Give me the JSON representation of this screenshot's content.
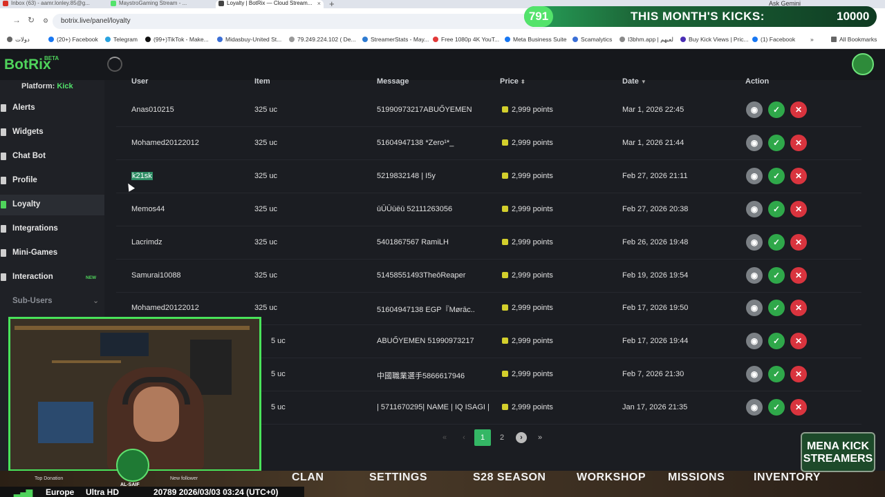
{
  "browser": {
    "tabs": [
      {
        "title": "Inbox (63) - aamr.lonley.85@g...",
        "color": "#d93025"
      },
      {
        "title": "MaystroGaming Stream - ...",
        "color": "#53e36b"
      },
      {
        "title": "Loyalty | BotRix — Cloud Stream...",
        "color": "#444444"
      }
    ],
    "new_tab": "+",
    "ask_gemini": "Ask Gemini",
    "url": "botrix.live/panel/loyalty",
    "bookmarks": [
      {
        "label": "دولات",
        "color": "#666666"
      },
      {
        "label": "(20+) Facebook",
        "color": "#1877f2"
      },
      {
        "label": "Telegram",
        "color": "#2aa3df"
      },
      {
        "label": "(99+)TikTok - Make...",
        "color": "#111111"
      },
      {
        "label": "Midasbuy-United St...",
        "color": "#3b6fd6"
      },
      {
        "label": "79.249.224.102 ( De...",
        "color": "#999999"
      },
      {
        "label": "StreamerStats - May...",
        "color": "#2e7bd1"
      },
      {
        "label": "Free 1080p 4K YouT...",
        "color": "#e23a3a"
      },
      {
        "label": "Meta Business Suite",
        "color": "#1877f2"
      },
      {
        "label": "Scamalytics",
        "color": "#3b6fd6"
      },
      {
        "label": "I3bhm.app | لعبهم",
        "color": "#8a8a8a"
      },
      {
        "label": "Buy Kick Views | Pric...",
        "color": "#4b2fb5"
      },
      {
        "label": "(1) Facebook",
        "color": "#1877f2"
      },
      {
        "label": "All Bookmarks",
        "color": "#666666"
      }
    ]
  },
  "overlay_kicks": {
    "count": "791",
    "title": "THIS MONTH'S KICKS:",
    "target": "10000"
  },
  "app": {
    "logo": "BotRix",
    "logo_badge": "BETA",
    "platform_label": "Platform:",
    "platform_value": "Kick",
    "nav": [
      {
        "label": "Alerts"
      },
      {
        "label": "Widgets"
      },
      {
        "label": "Chat Bot"
      },
      {
        "label": "Profile"
      },
      {
        "label": "Loyalty"
      },
      {
        "label": "Integrations"
      },
      {
        "label": "Mini-Games"
      },
      {
        "label": "Interaction",
        "tag": "NEW"
      },
      {
        "label": "Sub-Users"
      }
    ],
    "table": {
      "headers": {
        "user": "User",
        "item": "Item",
        "message": "Message",
        "price": "Price",
        "date": "Date",
        "action": "Action"
      },
      "rows": [
        {
          "user": "Anas010215",
          "item": "325 uc",
          "message": "51990973217ABUŐYEMEN",
          "price": "2,999 points",
          "date": "Mar 1, 2026 22:45"
        },
        {
          "user": "Mohamed20122012",
          "item": "325 uc",
          "message": "51604947138 *Zero¹*_",
          "price": "2,999 points",
          "date": "Mar 1, 2026 21:44"
        },
        {
          "user": "k21sk",
          "item": "325 uc",
          "message": "5219832148 | I5y",
          "price": "2,999 points",
          "date": "Feb 27, 2026 21:11"
        },
        {
          "user": "Memos44",
          "item": "325 uc",
          "message": "ūŪŪūēū 52111263056",
          "price": "2,999 points",
          "date": "Feb 27, 2026 20:38"
        },
        {
          "user": "Lacrimdz",
          "item": "325 uc",
          "message": "5401867567 RamiLH",
          "price": "2,999 points",
          "date": "Feb 26, 2026 19:48"
        },
        {
          "user": "Samurai10088",
          "item": "325 uc",
          "message": "51458551493TheōReaper",
          "price": "2,999 points",
          "date": "Feb 19, 2026 19:54"
        },
        {
          "user": "Mohamed20122012",
          "item": "325 uc",
          "message": "51604947138 EGP『Mørāc..",
          "price": "2,999 points",
          "date": "Feb 17, 2026 19:50"
        },
        {
          "user": "",
          "item": "5 uc",
          "message": "ABUŐYEMEN 51990973217",
          "price": "2,999 points",
          "date": "Feb 17, 2026 19:44"
        },
        {
          "user": "",
          "item": "5 uc",
          "message": "中國職業選手5866617946",
          "price": "2,999 points",
          "date": "Feb 7, 2026 21:30"
        },
        {
          "user": "",
          "item": "5 uc",
          "message": "| 5711670295| NAME | IQ ISAGI |",
          "price": "2,999 points",
          "date": "Jan 17, 2026 21:35"
        }
      ]
    },
    "pagination": {
      "first": "«",
      "prev": "‹",
      "current": "1",
      "next_page": "2",
      "next": "›",
      "last": "»"
    }
  },
  "game_hud": {
    "menu": [
      "CLAN",
      "SETTINGS",
      "S28 SEASON",
      "WORKSHOP",
      "MISSIONS",
      "INVENTORY"
    ],
    "region": "Europe",
    "quality": "Ultra HD",
    "status_line": "20789 2026/03/03 03:24 (UTC+0)",
    "top_donation": "Top Donation",
    "new_follower": "New follower",
    "sub_label": "AL-SAIF",
    "mena_line1": "MENA KICK",
    "mena_line2": "STREAMERS"
  }
}
